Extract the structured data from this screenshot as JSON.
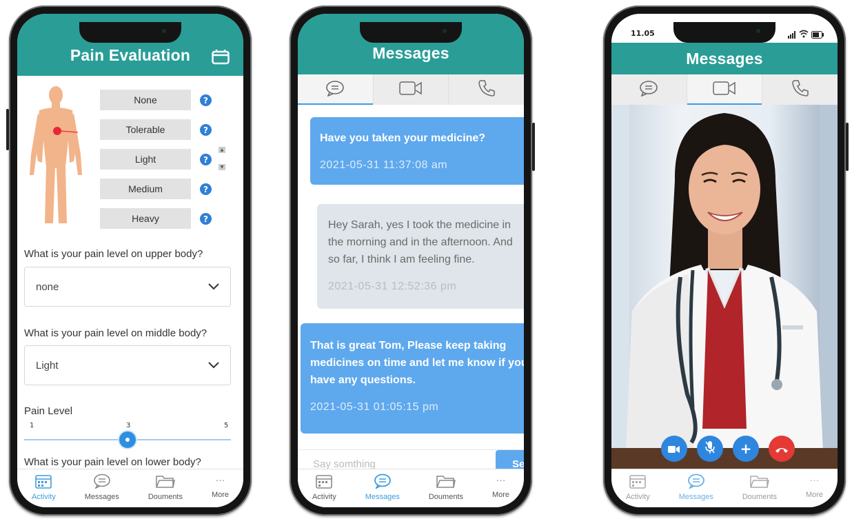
{
  "phone1": {
    "header_title": "Pain Evaluation",
    "levels": [
      "None",
      "Tolerable",
      "Light",
      "Medium",
      "Heavy"
    ],
    "help_glyph": "?",
    "q_upper": "What is your pain level on upper body?",
    "upper_value": "none",
    "q_middle": "What is your pain level on middle body?",
    "middle_value": "Light",
    "slider_label": "Pain Level",
    "slider_min": "1",
    "slider_current": "3",
    "slider_max": "5",
    "slider_fraction": 0.5,
    "q_lower": "What is your pain level on lower body?"
  },
  "phone2": {
    "header_title": "Messages",
    "messages": [
      {
        "from": "out",
        "text": "Have you taken your medicine?",
        "time": "2021-05-31   11:37:08 am"
      },
      {
        "from": "in",
        "text": "Hey Sarah, yes I took the medicine in the morning and in the afternoon. And so far, I think I am feeling fine.",
        "time": "2021-05-31   12:52:36 pm"
      },
      {
        "from": "out",
        "text": "That is great Tom, Please keep taking medicines on time and let me know if you have any questions.",
        "time": "2021-05-31   01:05:15 pm"
      }
    ],
    "input_placeholder": "Say somthing",
    "send_label": "Send"
  },
  "phone3": {
    "status_time": "11.05",
    "header_title": "Messages"
  },
  "nav": {
    "activity": "Activity",
    "messages": "Messages",
    "documents": "Douments",
    "more": "More"
  },
  "colors": {
    "header": "#2a9d97",
    "accent": "#3d9be0",
    "bubble_out": "#5ea8ed",
    "bubble_in": "#dfe5ea",
    "end_call": "#e53935"
  }
}
